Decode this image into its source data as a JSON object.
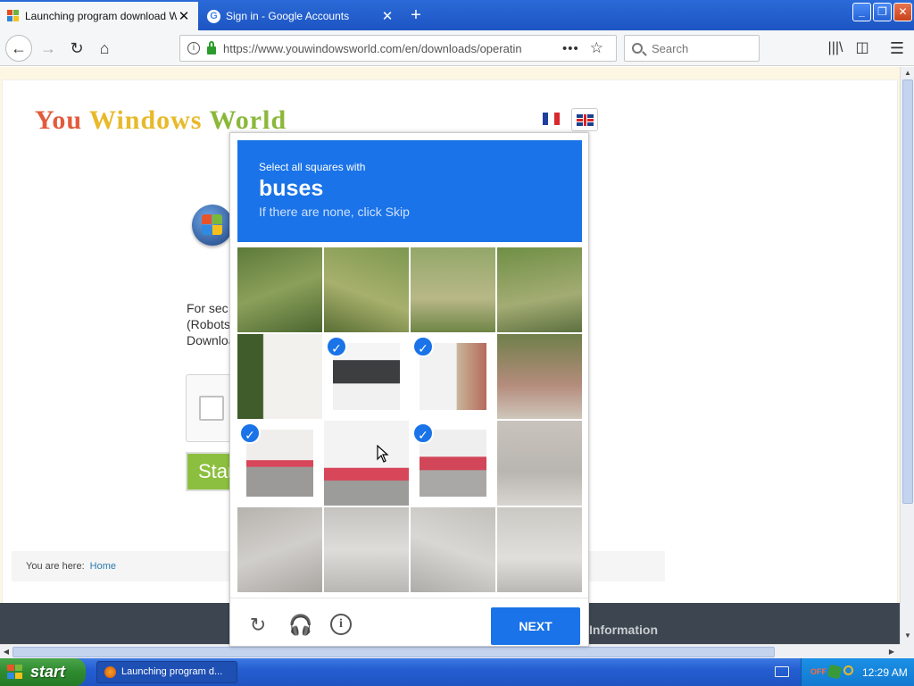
{
  "tabs": [
    {
      "title": "Launching program download Windows",
      "favicon": "windows-flag-icon"
    },
    {
      "title": "Sign in - Google Accounts",
      "favicon": "google-g-icon"
    }
  ],
  "address_bar": {
    "url": "https://www.youwindowsworld.com/en/downloads/operatin",
    "page_actions_glyph": "•••"
  },
  "search": {
    "placeholder": "Search"
  },
  "site": {
    "logo_part1": "You ",
    "logo_part2": "Windows ",
    "logo_part3": "World",
    "body_lines": [
      "For    sec                                                                              ns",
      "(Robots                                                                              art",
      "Downloa"
    ],
    "start_button": "Start",
    "breadcrumb_label": "You are here:",
    "breadcrumb_link": "Home",
    "footer_info": "Information"
  },
  "captcha": {
    "instruction": "Select all squares with",
    "target": "buses",
    "hint": "If there are none, click Skip",
    "next_label": "NEXT",
    "tiles_selected": [
      5,
      6,
      8,
      10
    ]
  },
  "taskbar": {
    "start_label": "start",
    "task_label": "Launching program d...",
    "tray_off": "OFF",
    "clock": "12:29 AM"
  },
  "colors": {
    "accent": "#1a73e8",
    "taskbar": "#245ed1",
    "logo_red": "#e25b3b",
    "logo_yellow": "#e8b92a",
    "logo_green": "#8bb83a"
  }
}
